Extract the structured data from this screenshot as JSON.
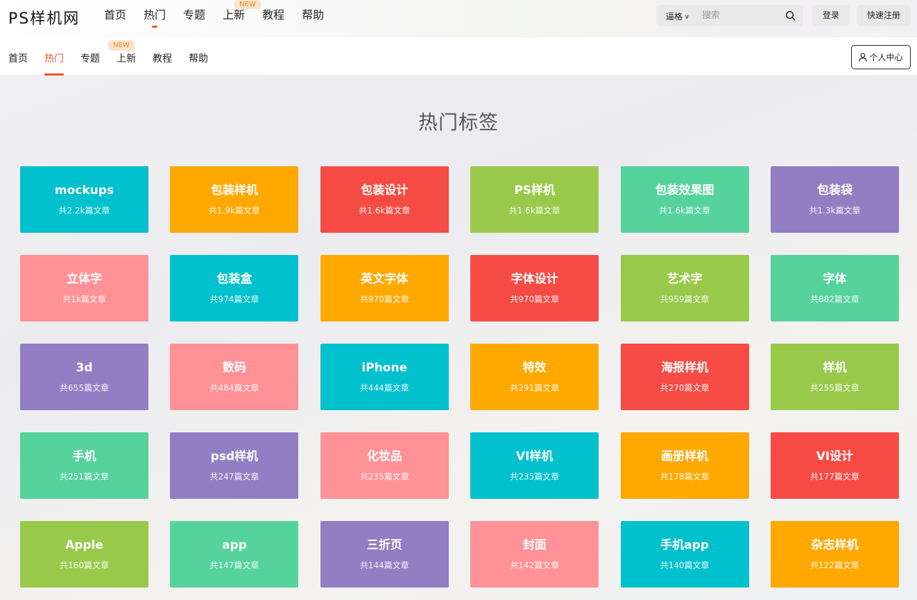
{
  "site": {
    "logo": "PS样机网"
  },
  "top_nav": [
    {
      "label": "首页",
      "active": false
    },
    {
      "label": "热门",
      "active": true
    },
    {
      "label": "专题",
      "active": false
    },
    {
      "label": "上新",
      "active": false,
      "badge": "NEW"
    },
    {
      "label": "教程",
      "active": false
    },
    {
      "label": "帮助",
      "active": false
    }
  ],
  "search": {
    "scope": "逼格",
    "placeholder": "搜索"
  },
  "auth": {
    "login": "登录",
    "register": "快速注册"
  },
  "sub_nav": [
    {
      "label": "首页",
      "active": false
    },
    {
      "label": "热门",
      "active": true
    },
    {
      "label": "专题",
      "active": false
    },
    {
      "label": "上新",
      "active": false,
      "badge": "NEW"
    },
    {
      "label": "教程",
      "active": false
    },
    {
      "label": "帮助",
      "active": false
    }
  ],
  "user_center": "个人中心",
  "page_title": "热门标签",
  "colors": {
    "cyan": "#00c1cd",
    "orange": "#ffa800",
    "red": "#f54b44",
    "green": "#99c94b",
    "mint": "#56d29d",
    "purple": "#937dc3",
    "pink": "#ff9197",
    "accent": "#e9582a"
  },
  "tags": [
    {
      "name": "mockups",
      "count": "共2.2k篇文章",
      "color": "cyan"
    },
    {
      "name": "包装样机",
      "count": "共1.9k篇文章",
      "color": "orange"
    },
    {
      "name": "包装设计",
      "count": "共1.6k篇文章",
      "color": "red"
    },
    {
      "name": "PS样机",
      "count": "共1.6k篇文章",
      "color": "green"
    },
    {
      "name": "包装效果图",
      "count": "共1.6k篇文章",
      "color": "mint"
    },
    {
      "name": "包装袋",
      "count": "共1.3k篇文章",
      "color": "purple"
    },
    {
      "name": "立体字",
      "count": "共1k篇文章",
      "color": "pink"
    },
    {
      "name": "包装盒",
      "count": "共974篇文章",
      "color": "cyan"
    },
    {
      "name": "英文字体",
      "count": "共970篇文章",
      "color": "orange"
    },
    {
      "name": "字体设计",
      "count": "共970篇文章",
      "color": "red"
    },
    {
      "name": "艺术字",
      "count": "共959篇文章",
      "color": "green"
    },
    {
      "name": "字体",
      "count": "共882篇文章",
      "color": "mint"
    },
    {
      "name": "3d",
      "count": "共655篇文章",
      "color": "purple"
    },
    {
      "name": "数码",
      "count": "共484篇文章",
      "color": "pink"
    },
    {
      "name": "iPhone",
      "count": "共444篇文章",
      "color": "cyan"
    },
    {
      "name": "特效",
      "count": "共291篇文章",
      "color": "orange"
    },
    {
      "name": "海报样机",
      "count": "共270篇文章",
      "color": "red"
    },
    {
      "name": "样机",
      "count": "共255篇文章",
      "color": "green"
    },
    {
      "name": "手机",
      "count": "共251篇文章",
      "color": "mint"
    },
    {
      "name": "psd样机",
      "count": "共247篇文章",
      "color": "purple"
    },
    {
      "name": "化妆品",
      "count": "共235篇文章",
      "color": "pink"
    },
    {
      "name": "VI样机",
      "count": "共235篇文章",
      "color": "cyan"
    },
    {
      "name": "画册样机",
      "count": "共178篇文章",
      "color": "orange"
    },
    {
      "name": "VI设计",
      "count": "共177篇文章",
      "color": "red"
    },
    {
      "name": "Apple",
      "count": "共160篇文章",
      "color": "green"
    },
    {
      "name": "app",
      "count": "共147篇文章",
      "color": "mint"
    },
    {
      "name": "三折页",
      "count": "共144篇文章",
      "color": "purple"
    },
    {
      "name": "封面",
      "count": "共142篇文章",
      "color": "pink"
    },
    {
      "name": "手机app",
      "count": "共140篇文章",
      "color": "cyan"
    },
    {
      "name": "杂志样机",
      "count": "共122篇文章",
      "color": "orange"
    }
  ]
}
